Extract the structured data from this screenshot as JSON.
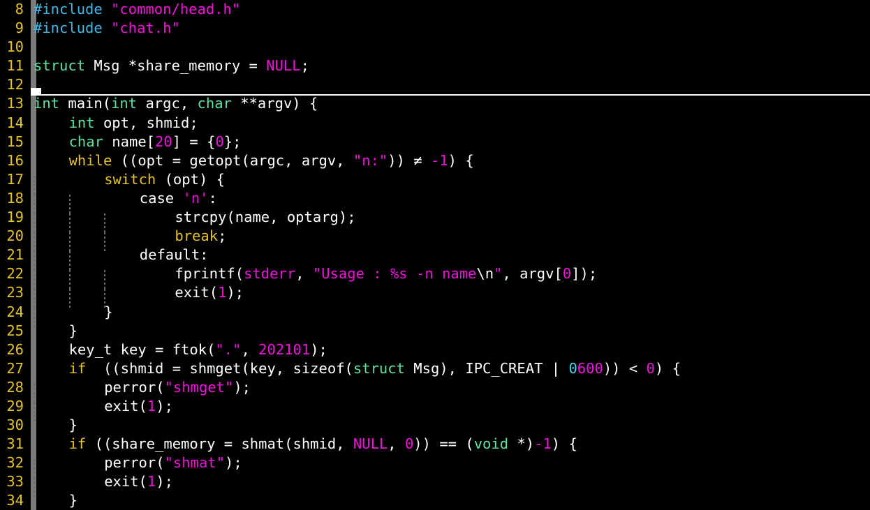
{
  "editor": {
    "kind": "terminal-code-editor",
    "language": "C",
    "background_color": "#000000",
    "first_visible_line": 8,
    "last_visible_line": 34,
    "colors": {
      "line_number": "#e6c229",
      "preprocessor": "#3fb8e8",
      "type_keyword": "#5fe3a1",
      "control_keyword": "#e6c229",
      "string_literal": "#f112dd",
      "number_literal": "#f112dd",
      "octal_prefix": "#3fd9e8",
      "identifier": "#ffffff",
      "indent_guide": "#6b6b6b",
      "scrollbar_track": "#7a7a7a",
      "scrollbar_thumb": "#ffffff",
      "fold_rule": "#ffffff"
    }
  },
  "gutter": {
    "line_numbers": [
      8,
      9,
      10,
      11,
      12,
      13,
      14,
      15,
      16,
      17,
      18,
      19,
      20,
      21,
      22,
      23,
      24,
      25,
      26,
      27,
      28,
      29,
      30,
      31,
      32,
      33,
      34
    ]
  },
  "code_lines": [
    {
      "n": 8,
      "text": "#include \"common/head.h\""
    },
    {
      "n": 9,
      "text": "#include \"chat.h\""
    },
    {
      "n": 10,
      "text": ""
    },
    {
      "n": 11,
      "text": "struct Msg *share_memory = NULL;"
    },
    {
      "n": 12,
      "text": ""
    },
    {
      "n": 13,
      "text": "int main(int argc, char **argv) {"
    },
    {
      "n": 14,
      "text": "    int opt, shmid;"
    },
    {
      "n": 15,
      "text": "    char name[20] = {0};"
    },
    {
      "n": 16,
      "text": "    while ((opt = getopt(argc, argv, \"n:\")) != -1) {"
    },
    {
      "n": 17,
      "text": "        switch (opt) {"
    },
    {
      "n": 18,
      "text": "            case 'n':"
    },
    {
      "n": 19,
      "text": "                strcpy(name, optarg);"
    },
    {
      "n": 20,
      "text": "                break;"
    },
    {
      "n": 21,
      "text": "            default:"
    },
    {
      "n": 22,
      "text": "                fprintf(stderr, \"Usage : %s -n name\\n\", argv[0]);"
    },
    {
      "n": 23,
      "text": "                exit(1);"
    },
    {
      "n": 24,
      "text": "        }"
    },
    {
      "n": 25,
      "text": "    }"
    },
    {
      "n": 26,
      "text": "    key_t key = ftok(\".\", 202101);"
    },
    {
      "n": 27,
      "text": "    if  ((shmid = shmget(key, sizeof(struct Msg), IPC_CREAT | 0600)) < 0) {"
    },
    {
      "n": 28,
      "text": "        perror(\"shmget\");"
    },
    {
      "n": 29,
      "text": "        exit(1);"
    },
    {
      "n": 30,
      "text": "    }"
    },
    {
      "n": 31,
      "text": "    if ((share_memory = shmat(shmid, NULL, 0)) == (void *)-1) {"
    },
    {
      "n": 32,
      "text": "        perror(\"shmat\");"
    },
    {
      "n": 33,
      "text": "        exit(1);"
    },
    {
      "n": 34,
      "text": "    }"
    }
  ],
  "tokens": {
    "l8": {
      "pre": "#include",
      "str": "\"common/head.h\""
    },
    "l9": {
      "pre": "#include",
      "str": "\"chat.h\""
    },
    "l11": {
      "kw_struct": "struct",
      "id_msg": " Msg *share_memory = ",
      "null": "NULL",
      "semi": ";"
    },
    "l13": {
      "t1": "int",
      "a": " main(",
      "t2": "int",
      "b": " argc, ",
      "t3": "char",
      "c": " **argv) {"
    },
    "l14": {
      "t1": "int",
      "a": " opt, shmid;"
    },
    "l15": {
      "t1": "char",
      "a": " name[",
      "num": "20",
      "b": "] = {",
      "num2": "0",
      "c": "};"
    },
    "l16": {
      "kw": "while",
      "a": " ((opt = getopt(argc, argv, ",
      "str": "\"n:\"",
      "b": ")) ",
      "neq": "≠",
      "c": " ",
      "num": "-1",
      "d": ") {"
    },
    "l17": {
      "kw": "switch",
      "a": " (opt) {"
    },
    "l18": {
      "a": "case ",
      "chr": "'n'",
      "b": ":"
    },
    "l19": {
      "a": "strcpy(name, optarg);"
    },
    "l20": {
      "kw": "break",
      "a": ";"
    },
    "l21": {
      "a": "default:"
    },
    "l22": {
      "a": "fprintf(",
      "stderr": "stderr",
      "b": ", ",
      "str1": "\"Usage : %s -n name",
      "esc": "\\n",
      "str2": "\"",
      "c": ", argv[",
      "num": "0",
      "d": "]);"
    },
    "l23": {
      "a": "exit(",
      "num": "1",
      "b": ");"
    },
    "l24": {
      "a": "}"
    },
    "l25": {
      "a": "}"
    },
    "l26": {
      "a": "key_t key = ftok(",
      "str": "\".\"",
      "b": ", ",
      "num": "202101",
      "c": ");"
    },
    "l27": {
      "kw": "if",
      "a": "  ((shmid = shmget(key, sizeof(",
      "kw2": "struct",
      "b": " Msg), IPC_CREAT | ",
      "oct": "0",
      "num": "600",
      "c": ")) < ",
      "num2": "0",
      "d": ") {"
    },
    "l28": {
      "a": "perror(",
      "str": "\"shmget\"",
      "b": ");"
    },
    "l29": {
      "a": "exit(",
      "num": "1",
      "b": ");"
    },
    "l30": {
      "a": "}"
    },
    "l31": {
      "kw": "if",
      "a": " ((share_memory = shmat(shmid, ",
      "null": "NULL",
      "b": ", ",
      "num": "0",
      "c": ")) == (",
      "void": "void",
      "d": " *)",
      "num2": "-1",
      "e": ") {"
    },
    "l32": {
      "a": "perror(",
      "str": "\"shmat\"",
      "b": ");"
    },
    "l33": {
      "a": "exit(",
      "num": "1",
      "b": ");"
    },
    "l34": {
      "a": "}"
    }
  }
}
